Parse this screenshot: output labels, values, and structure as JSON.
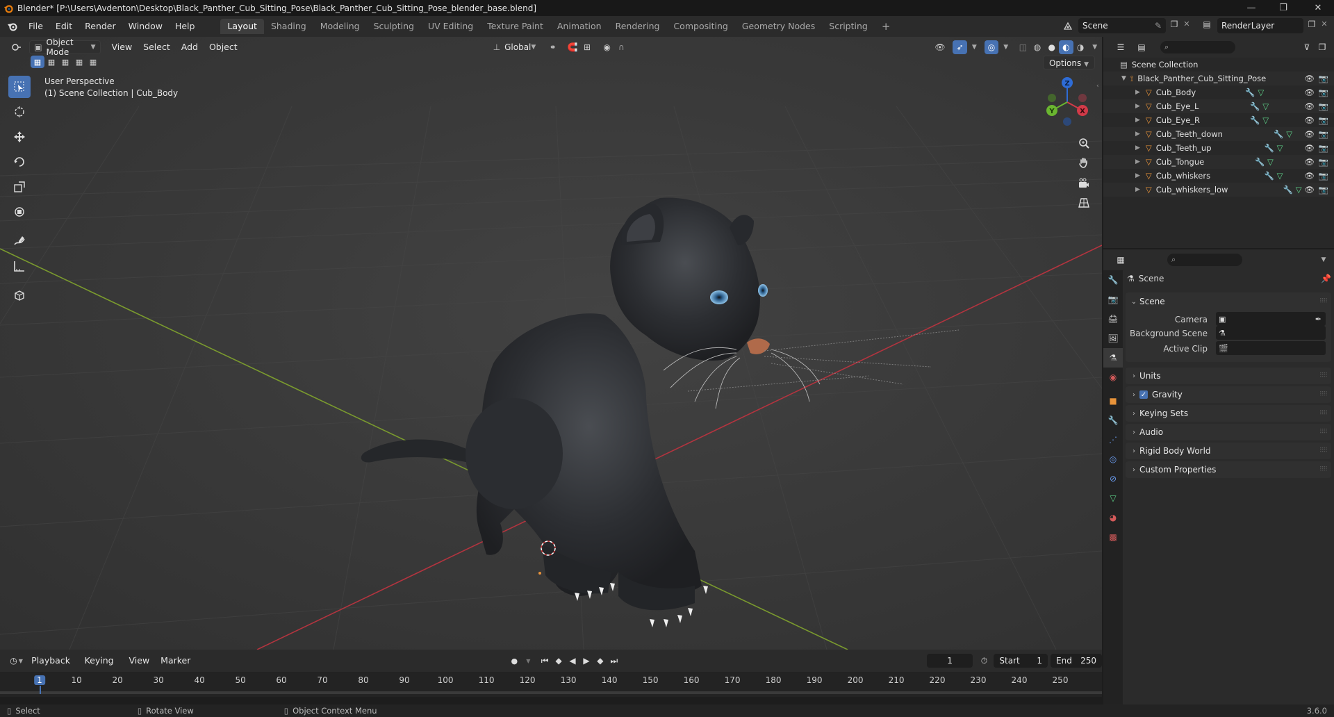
{
  "window": {
    "title": "Blender* [P:\\Users\\Avdenton\\Desktop\\Black_Panther_Cub_Sitting_Pose\\Black_Panther_Cub_Sitting_Pose_blender_base.blend]",
    "minimize": "—",
    "maximize": "❐",
    "close": "✕"
  },
  "menu": [
    "File",
    "Edit",
    "Render",
    "Window",
    "Help"
  ],
  "workspaces": [
    "Layout",
    "Shading",
    "Modeling",
    "Sculpting",
    "UV Editing",
    "Texture Paint",
    "Animation",
    "Rendering",
    "Compositing",
    "Geometry Nodes",
    "Scripting"
  ],
  "workspace_add": "+",
  "scene_name": "Scene",
  "view_layer": "RenderLayer",
  "viewport": {
    "mode": "Object Mode",
    "menus": [
      "View",
      "Select",
      "Add",
      "Object"
    ],
    "orientation": "Global",
    "options": "Options",
    "view_name": "User Perspective",
    "view_context": "(1) Scene Collection | Cub_Body",
    "gizmo": {
      "z": "Z",
      "y": "Y",
      "x": "X"
    }
  },
  "outliner": {
    "root": "Scene Collection",
    "collection": "Black_Panther_Cub_Sitting_Pose",
    "objects": [
      "Cub_Body",
      "Cub_Eye_L",
      "Cub_Eye_R",
      "Cub_Teeth_down",
      "Cub_Teeth_up",
      "Cub_Tongue",
      "Cub_whiskers",
      "Cub_whiskers_low"
    ]
  },
  "properties": {
    "context": "Scene",
    "scene_panel": {
      "title": "Scene",
      "fields": [
        {
          "label": "Camera"
        },
        {
          "label": "Background Scene"
        },
        {
          "label": "Active Clip"
        }
      ]
    },
    "collapsed_panels": [
      "Units",
      "Gravity",
      "Keying Sets",
      "Audio",
      "Rigid Body World",
      "Custom Properties"
    ],
    "gravity_checked": "✓"
  },
  "timeline": {
    "menus": [
      "Playback",
      "Keying",
      "View",
      "Marker"
    ],
    "current_frame": "1",
    "start_label": "Start",
    "start_value": "1",
    "end_label": "End",
    "end_value": "250",
    "ruler": [
      "1",
      "10",
      "20",
      "30",
      "40",
      "50",
      "60",
      "70",
      "80",
      "90",
      "100",
      "110",
      "120",
      "130",
      "140",
      "150",
      "160",
      "170",
      "180",
      "190",
      "200",
      "210",
      "220",
      "230",
      "240",
      "250"
    ]
  },
  "status": {
    "select": "Select",
    "rotate": "Rotate View",
    "context_menu": "Object Context Menu",
    "version": "3.6.0"
  },
  "colors": {
    "accent": "#4772b3",
    "object_orange": "#e8933a",
    "mesh_green": "#5fd38a",
    "modifier_blue": "#6a9cf0"
  }
}
